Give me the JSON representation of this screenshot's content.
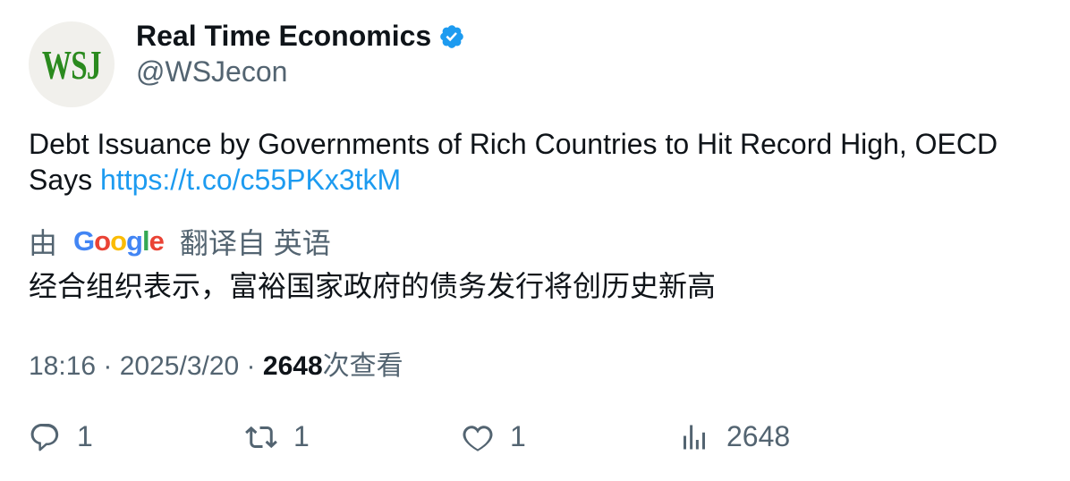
{
  "author": {
    "name": "Real Time Economics",
    "handle": "@WSJecon",
    "avatar_text": "WSJ",
    "verified": true
  },
  "tweet": {
    "text": "Debt Issuance by Governments of Rich Countries to Hit Record High, OECD Says ",
    "link": "https://t.co/c55PKx3tkM"
  },
  "translation": {
    "prefix": "由",
    "provider": "Google",
    "suffix": "翻译自 英语",
    "text": "经合组织表示，富裕国家政府的债务发行将创历史新高"
  },
  "meta": {
    "time": "18:16",
    "sep": " · ",
    "date": "2025/3/20",
    "views": "2648",
    "views_label": "次查看"
  },
  "actions": {
    "replies": "1",
    "retweets": "1",
    "likes": "1",
    "views": "2648"
  },
  "colors": {
    "text": "#0f1419",
    "secondary": "#536471",
    "link": "#1d9bf0",
    "verified": "#1d9bf0"
  }
}
